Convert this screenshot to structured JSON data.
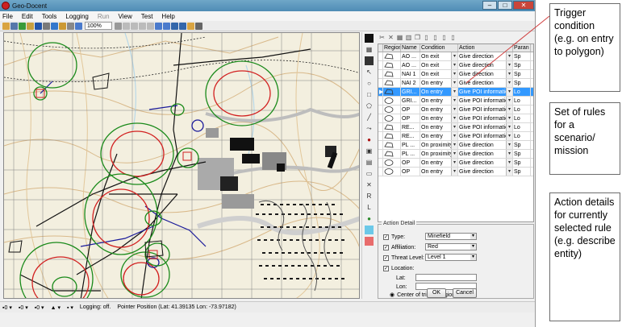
{
  "window": {
    "title": "Geo-Docent",
    "min": "–",
    "max": "□",
    "close": "✕"
  },
  "menu": [
    "File",
    "Edit",
    "Tools",
    "Logging",
    "Run",
    "View",
    "Test",
    "Help"
  ],
  "toolbar": {
    "zoom": "100%"
  },
  "rules_table": {
    "columns": [
      "Region",
      "Name",
      "Condition",
      "Action",
      "Paran"
    ],
    "rows": [
      {
        "shape": "poly",
        "name": "AO ...",
        "condition": "On exit",
        "action": "Give direction",
        "param": "Sp",
        "selected": false
      },
      {
        "shape": "poly",
        "name": "AO ...",
        "condition": "On exit",
        "action": "Give direction",
        "param": "Sp",
        "selected": false
      },
      {
        "shape": "poly",
        "name": "NAI 1",
        "condition": "On exit",
        "action": "Give direction",
        "param": "Sp",
        "selected": false
      },
      {
        "shape": "poly",
        "name": "NAI 2",
        "condition": "On entry",
        "action": "Give direction",
        "param": "Sp",
        "selected": false
      },
      {
        "shape": "poly",
        "name": "GRI...",
        "condition": "On entry",
        "action": "Give POI information",
        "param": "Lo",
        "selected": true
      },
      {
        "shape": "circle",
        "name": "GRI...",
        "condition": "On entry",
        "action": "Give POI information",
        "param": "Lo",
        "selected": false
      },
      {
        "shape": "circle",
        "name": "OP",
        "condition": "On entry",
        "action": "Give POI information",
        "param": "Lo",
        "selected": false
      },
      {
        "shape": "circle",
        "name": "OP",
        "condition": "On entry",
        "action": "Give POI information",
        "param": "Lo",
        "selected": false
      },
      {
        "shape": "poly",
        "name": "RE...",
        "condition": "On entry",
        "action": "Give POI information",
        "param": "Lo",
        "selected": false
      },
      {
        "shape": "poly",
        "name": "RE...",
        "condition": "On entry",
        "action": "Give POI information",
        "param": "Lo",
        "selected": false
      },
      {
        "shape": "poly",
        "name": "PL ...",
        "condition": "On proximity",
        "action": "Give direction",
        "param": "Sp",
        "selected": false
      },
      {
        "shape": "poly",
        "name": "PL ...",
        "condition": "On proximity",
        "action": "Give direction",
        "param": "Sp",
        "selected": false
      },
      {
        "shape": "circle",
        "name": "OP",
        "condition": "On entry",
        "action": "Give direction",
        "param": "Sp",
        "selected": false
      },
      {
        "shape": "circle",
        "name": "OP",
        "condition": "On entry",
        "action": "Give direction",
        "param": "Sp",
        "selected": false
      }
    ]
  },
  "action_detail": {
    "legend": "Action Detail",
    "type_label": "Type:",
    "type_value": "Minefield",
    "affiliation_label": "Affiliation:",
    "affiliation_value": "Red",
    "threat_label": "Threat Level:",
    "threat_value": "Level 1",
    "location_label": "Location:",
    "lat_label": "Lat:",
    "lon_label": "Lon:",
    "center_label": "Center of trigger region",
    "ok": "OK",
    "cancel": "Cancel"
  },
  "status": {
    "c1": "0",
    "c2": "0",
    "c3": "0",
    "logging": "Logging: off.",
    "pointer": "Pointer Position (Lat: 41.39135  Lon: -73.97182)"
  },
  "callouts": {
    "trigger": "Trigger condition (e.g. on entry to polygon)",
    "rules": "Set of rules for a scenario/ mission",
    "action": "Action details for currently selected rule (e.g. describe entity)"
  },
  "colors": {
    "selection": "#3399ff",
    "red_region": "#d22020",
    "green_region": "#1a8a1a",
    "route": "#1a1a9a"
  }
}
